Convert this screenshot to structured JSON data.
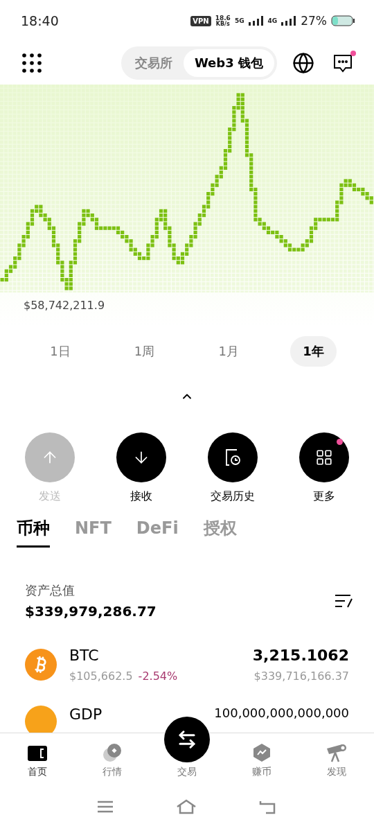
{
  "status_bar": {
    "time": "18:40",
    "vpn": "VPN",
    "speed": "18.6",
    "speed_unit": "KB/s",
    "net_primary": "5G",
    "net_secondary": "4G",
    "battery": "27%"
  },
  "header": {
    "tabs": [
      {
        "label": "交易所",
        "selected": false
      },
      {
        "label": "Web3 钱包",
        "selected": true
      }
    ],
    "messages_badge": true
  },
  "chart": {
    "low_label": "$58,742,211.9"
  },
  "ranges": [
    {
      "label": "1日",
      "selected": false
    },
    {
      "label": "1周",
      "selected": false
    },
    {
      "label": "1月",
      "selected": false
    },
    {
      "label": "1年",
      "selected": true
    }
  ],
  "actions": [
    {
      "kind": "send",
      "label": "发送",
      "disabled": true,
      "badge": false
    },
    {
      "kind": "receive",
      "label": "接收",
      "disabled": false,
      "badge": false
    },
    {
      "kind": "history",
      "label": "交易历史",
      "disabled": false,
      "badge": false
    },
    {
      "kind": "more",
      "label": "更多",
      "disabled": false,
      "badge": true
    }
  ],
  "asset_tabs": [
    {
      "label": "币种",
      "selected": true
    },
    {
      "label": "NFT",
      "selected": false
    },
    {
      "label": "DeFi",
      "selected": false
    },
    {
      "label": "授权",
      "selected": false
    }
  ],
  "total": {
    "label": "资产总值",
    "value": "$339,979,286.77"
  },
  "assets": [
    {
      "kind": "btc",
      "symbol": "BTC",
      "price": "$105,662.5",
      "change": "-2.54%",
      "amount": "3,215.1062",
      "value": "$339,716,166.37"
    },
    {
      "kind": "gdp",
      "symbol": "GDP",
      "amount": "100,000,000,000,000"
    }
  ],
  "bottom_nav": [
    {
      "kind": "wallet",
      "label": "首页",
      "selected": true
    },
    {
      "kind": "market",
      "label": "行情",
      "selected": false
    },
    {
      "kind": "swap",
      "label": "交易",
      "selected": false
    },
    {
      "kind": "earn",
      "label": "赚币",
      "selected": false
    },
    {
      "kind": "discover",
      "label": "发现",
      "selected": false
    }
  ]
}
